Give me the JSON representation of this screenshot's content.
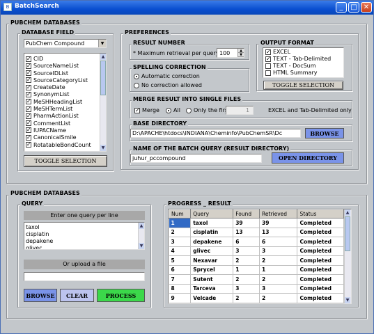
{
  "window": {
    "title": "BatchSearch"
  },
  "top_group": {
    "label": "PUBCHEM DATABASES"
  },
  "db_field": {
    "label": "DATABASE  FIELD",
    "select_value": "PubChem Compound",
    "fields": [
      "CID",
      "SourceNameList",
      "SourceIDList",
      "SourceCategoryList",
      "CreateDate",
      "SynonymList",
      "MeSHHeadingList",
      "MeSHTermList",
      "PharmActionList",
      "CommentList",
      "IUPACName",
      "CanonicalSmile",
      "RotatableBondCount"
    ],
    "toggle_label": "TOGGLE  SELECTION"
  },
  "preferences": {
    "label": "PREFERENCES",
    "result_number": {
      "label": "RESULT NUMBER",
      "text": "* Maximum retrieval per query",
      "value": "100"
    },
    "spelling": {
      "label": "SPELLING CORRECTION",
      "opt1": "Automatic correction",
      "opt2": "No correction allowed"
    },
    "output": {
      "label": "OUTPUT FORMAT",
      "opts": [
        {
          "label": "EXCEL",
          "checked": true
        },
        {
          "label": "TEXT - Tab-Delimited",
          "checked": true
        },
        {
          "label": "TEXT - DocSum",
          "checked": false
        },
        {
          "label": "HTML Summary",
          "checked": false
        }
      ],
      "toggle_label": "TOGGLE  SELECTION"
    },
    "merge": {
      "label": "MERGE RESULT INTO SINGLE FILES",
      "merge_label": "Merge",
      "all_label": "All",
      "first_label": "Only the first",
      "first_value": "1",
      "note": "EXCEL and Tab-Delimited only"
    },
    "base_dir": {
      "label": "BASE DIRECTORY",
      "value": "D:\\APACHE\\htdocs\\INDIANA\\Cheminfo\\PubChemSR\\Dc",
      "browse_label": "BROWSE"
    },
    "batch": {
      "label": "NAME OF THE BATCH QUERY (RESULT DIRECTORY)",
      "value": "juhur_pccompound",
      "open_label": "OPEN DIRECTORY"
    }
  },
  "bottom_group": {
    "label": "PUBCHEM DATABASES"
  },
  "query": {
    "label": "QUERY",
    "enter_label": "Enter one query per line",
    "lines": [
      "taxol",
      "cisplatin",
      "depakene",
      "glivec"
    ],
    "upload_label": "Or upload a file",
    "browse_label": "BROWSE",
    "clear_label": "CLEAR",
    "process_label": "PROCESS"
  },
  "progress": {
    "label": "PROGRESS _ RESULT",
    "columns": [
      "Num",
      "Query",
      "Found",
      "Retrieved",
      "Status"
    ],
    "rows": [
      [
        "1",
        "taxol",
        "39",
        "39",
        "Completed"
      ],
      [
        "2",
        "cisplatin",
        "13",
        "13",
        "Completed"
      ],
      [
        "3",
        "depakene",
        "6",
        "6",
        "Completed"
      ],
      [
        "4",
        "glivec",
        "3",
        "3",
        "Completed"
      ],
      [
        "5",
        "Nexavar",
        "2",
        "2",
        "Completed"
      ],
      [
        "6",
        "Sprycel",
        "1",
        "1",
        "Completed"
      ],
      [
        "7",
        "Sutent",
        "2",
        "2",
        "Completed"
      ],
      [
        "8",
        "Tarceva",
        "3",
        "3",
        "Completed"
      ],
      [
        "9",
        "Velcade",
        "2",
        "2",
        "Completed"
      ]
    ]
  }
}
